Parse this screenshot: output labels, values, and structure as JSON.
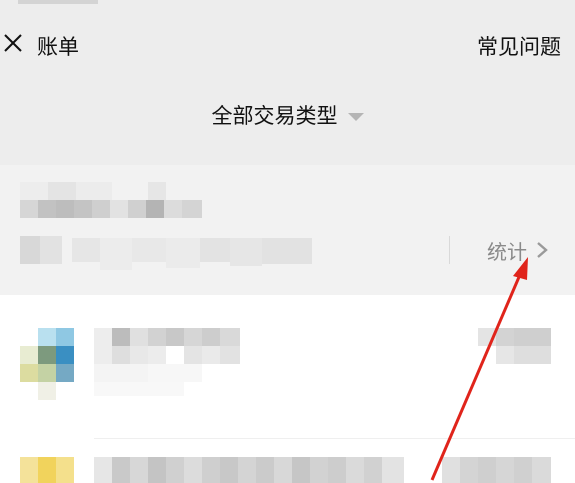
{
  "navbar": {
    "close_icon": "close-icon",
    "title": "账单",
    "faq_label": "常见问题"
  },
  "filter": {
    "label": "全部交易类型",
    "caret_icon": "caret-down-icon"
  },
  "summary": {
    "stats_label": "统计",
    "chevron_icon": "chevron-right-icon"
  },
  "annotation": {
    "color": "#e0241b"
  }
}
